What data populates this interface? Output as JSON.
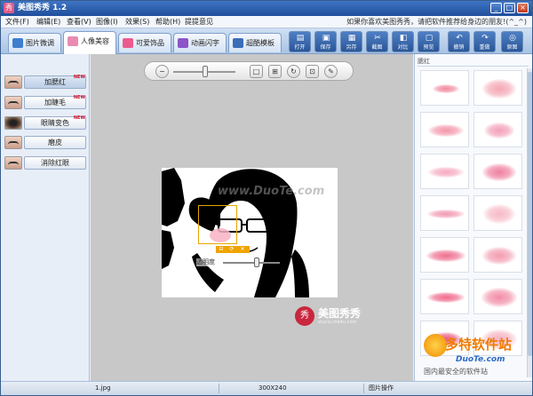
{
  "window": {
    "title": "美图秀秀 1.2",
    "app_icon": "秀",
    "minimize": "_",
    "maximize": "□",
    "close": "×"
  },
  "menu": {
    "items": [
      {
        "label": "文件(F)"
      },
      {
        "label": "编辑(E)"
      },
      {
        "label": "查看(V)"
      },
      {
        "label": "图像(I)"
      },
      {
        "label": "效果(S)"
      },
      {
        "label": "帮助(H)"
      },
      {
        "label": "提提意见"
      }
    ],
    "notice": "如果你喜欢美图秀秀，请把软件推荐给身边的朋友!(^_^)"
  },
  "tabs": [
    {
      "label": "图片微调",
      "icon": "picture-icon",
      "color": "#3f7ecf",
      "active": false
    },
    {
      "label": "人像美容",
      "icon": "portrait-icon",
      "color": "#e98bb1",
      "active": true
    },
    {
      "label": "可爱饰品",
      "icon": "decoration-icon",
      "color": "#ec5b8e",
      "active": false
    },
    {
      "label": "动画闪字",
      "icon": "animation-icon",
      "color": "#8c55c8",
      "active": false
    },
    {
      "label": "超酷模板",
      "icon": "template-icon",
      "color": "#3b6db8",
      "active": false
    }
  ],
  "toolbar": [
    {
      "label": "打开",
      "icon": "open-icon",
      "glyph": "▤"
    },
    {
      "label": "保存",
      "icon": "save-icon",
      "glyph": "▣"
    },
    {
      "label": "另存",
      "icon": "save-as-icon",
      "glyph": "▦"
    },
    {
      "label": "截图",
      "icon": "screenshot-icon",
      "glyph": "✂"
    },
    {
      "label": "对比",
      "icon": "compare-icon",
      "glyph": "◧"
    },
    {
      "label": "预览",
      "icon": "preview-icon",
      "glyph": "▢"
    },
    {
      "label": "撤销",
      "icon": "undo-icon",
      "glyph": "↶"
    },
    {
      "label": "重做",
      "icon": "redo-icon",
      "glyph": "↷"
    },
    {
      "label": "原图",
      "icon": "original-icon",
      "glyph": "◎"
    }
  ],
  "effects": [
    {
      "label": "加腮红",
      "selected": true,
      "new": true
    },
    {
      "label": "加睫毛",
      "selected": false,
      "new": true
    },
    {
      "label": "眼睛变色",
      "selected": false,
      "new": true
    },
    {
      "label": "磨皮",
      "selected": false,
      "new": false
    },
    {
      "label": "消除红眼",
      "selected": false,
      "new": false
    }
  ],
  "new_badge": "NEW",
  "zoombar": {
    "zoom_out": "−",
    "zoom_level": 0.52,
    "buttons": [
      {
        "name": "actual-size-button",
        "glyph": "□",
        "icon": "actual-size-icon"
      },
      {
        "name": "fit-window-button",
        "glyph": "⊞",
        "icon": "fit-window-icon"
      },
      {
        "name": "rotate-button",
        "glyph": "↻",
        "icon": "rotate-icon"
      },
      {
        "name": "crop-button",
        "glyph": "⊡",
        "icon": "crop-icon"
      },
      {
        "name": "brush-button",
        "glyph": "✎",
        "icon": "brush-icon"
      }
    ]
  },
  "canvas": {
    "watermark": "www.DuoTe.com",
    "selection_buttons": [
      "⊟",
      "⟳",
      "✕"
    ],
    "opacity_label": "透明度",
    "opacity_value": 0.6
  },
  "brand": {
    "logo": "秀",
    "name": "美图秀秀",
    "url": "xiuxiu.meitu.com"
  },
  "right_panel": {
    "title": "腮红",
    "blush_colors": [
      "#f28aa0",
      "#f5a7b5",
      "#f497ac",
      "#f2a0b8",
      "#f6aac0",
      "#ef7fa0",
      "#f39ab4",
      "#f7b9c6",
      "#ee6f8f",
      "#f29cb0",
      "#f06a8c",
      "#f28da6",
      "#ea5b82",
      "#f5b2c2"
    ]
  },
  "watermark2": {
    "brand": "多特软件站",
    "site": "DuoTe.com",
    "slogan": "国内最安全的软件站"
  },
  "status": {
    "file": "1.jpg",
    "dims": "300X240",
    "mode": "图片操作"
  }
}
